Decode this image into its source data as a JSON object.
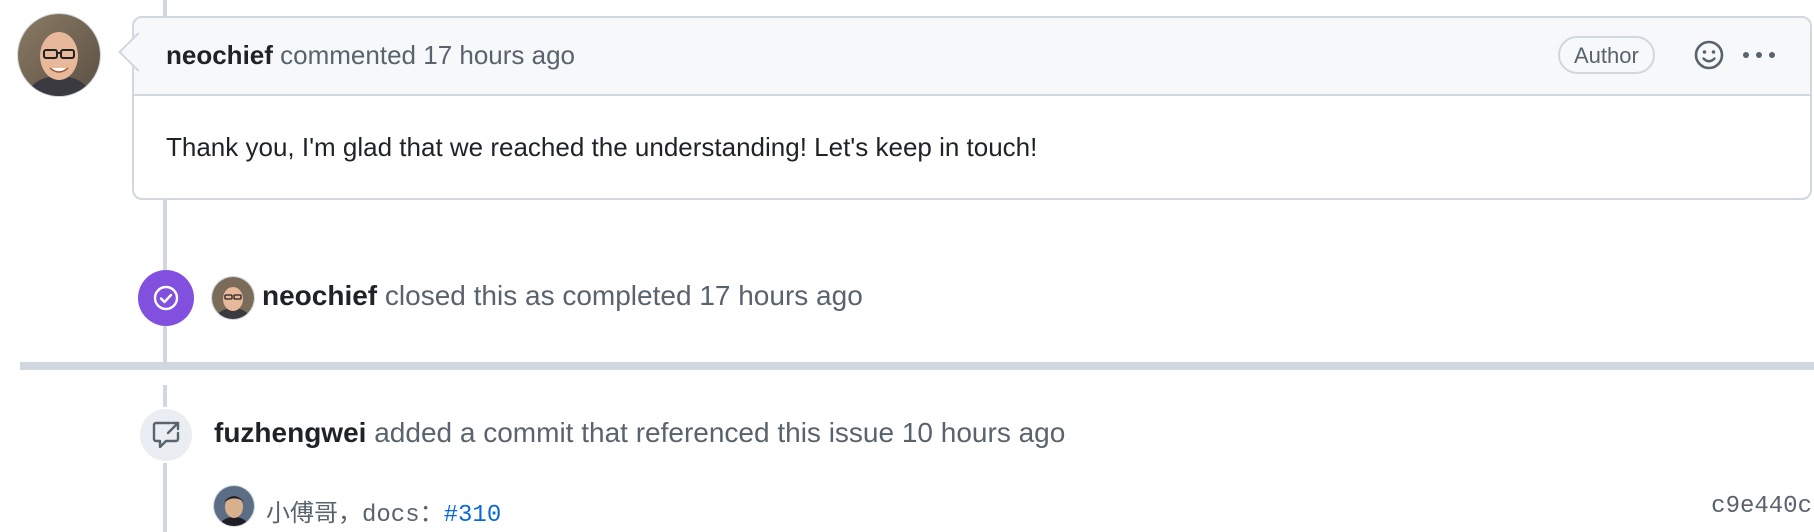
{
  "comment": {
    "author": "neochief",
    "action": "commented",
    "time": "17 hours ago",
    "badge": "Author",
    "body": "Thank you, I'm glad that we reached the understanding! Let's keep in touch!",
    "icons": {
      "reaction": "smiley-icon",
      "menu": "kebab-horizontal-icon"
    }
  },
  "closed_event": {
    "actor": "neochief",
    "text": "closed this as completed",
    "time": "17 hours ago",
    "icon": "check-circle-icon",
    "colors": {
      "badge": "#8250df"
    }
  },
  "commit_event": {
    "actor": "fuzhengwei",
    "text": "added a commit that referenced this issue",
    "time": "10 hours ago",
    "icon": "cross-reference-icon",
    "commit": {
      "message_prefix": "小傅哥，docs：",
      "reference": "#310",
      "sha": "c9e440c"
    }
  },
  "colors": {
    "border": "#d0d7de",
    "muted_text": "#59636e",
    "link": "#0969da",
    "header_bg": "#f6f8fa"
  }
}
